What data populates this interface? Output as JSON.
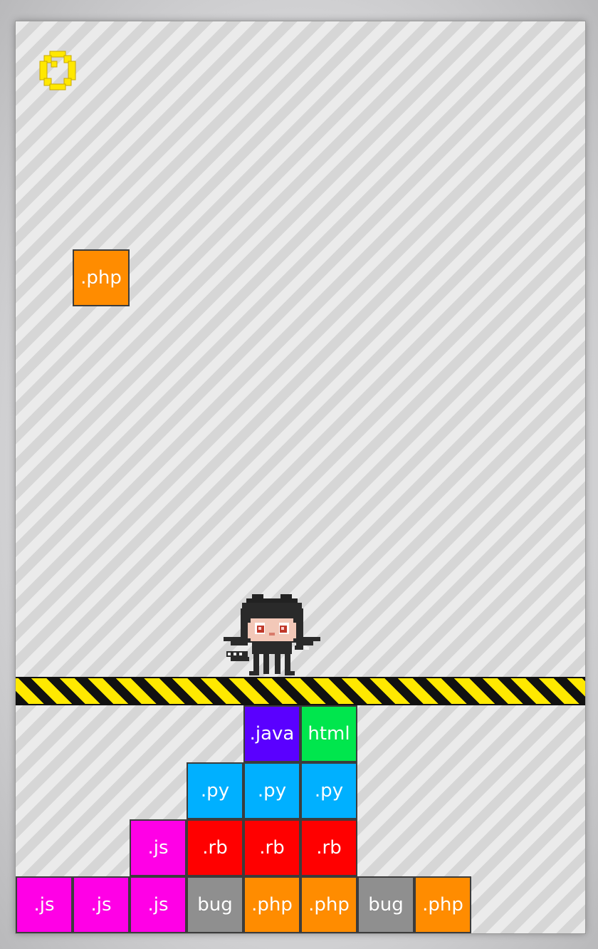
{
  "game": {
    "score": "0",
    "score_color": "#ffe800",
    "player_icon": "octocat-sprite"
  },
  "falling_block": {
    "label": ".php",
    "color": "#ff8c00",
    "col": 1,
    "row": 4
  },
  "grid": {
    "cols": 10,
    "cell": 80
  },
  "stack": [
    {
      "label": ".java",
      "color": "#5a00ff",
      "col": 4,
      "row": 0
    },
    {
      "label": "html",
      "color": "#00e64d",
      "col": 5,
      "row": 0
    },
    {
      "label": ".py",
      "color": "#00b0ff",
      "col": 3,
      "row": 1
    },
    {
      "label": ".py",
      "color": "#00b0ff",
      "col": 4,
      "row": 1
    },
    {
      "label": ".py",
      "color": "#00b0ff",
      "col": 5,
      "row": 1
    },
    {
      "label": ".js",
      "color": "#ff00e6",
      "col": 2,
      "row": 2
    },
    {
      "label": ".rb",
      "color": "#ff0000",
      "col": 3,
      "row": 2
    },
    {
      "label": ".rb",
      "color": "#ff0000",
      "col": 4,
      "row": 2
    },
    {
      "label": ".rb",
      "color": "#ff0000",
      "col": 5,
      "row": 2
    },
    {
      "label": ".js",
      "color": "#ff00e6",
      "col": 0,
      "row": 3
    },
    {
      "label": ".js",
      "color": "#ff00e6",
      "col": 1,
      "row": 3
    },
    {
      "label": ".js",
      "color": "#ff00e6",
      "col": 2,
      "row": 3
    },
    {
      "label": "bug",
      "color": "#8f8f8f",
      "col": 3,
      "row": 3
    },
    {
      "label": ".php",
      "color": "#ff8c00",
      "col": 4,
      "row": 3
    },
    {
      "label": ".php",
      "color": "#ff8c00",
      "col": 5,
      "row": 3
    },
    {
      "label": "bug",
      "color": "#8f8f8f",
      "col": 6,
      "row": 3
    },
    {
      "label": ".php",
      "color": "#ff8c00",
      "col": 7,
      "row": 3
    }
  ]
}
